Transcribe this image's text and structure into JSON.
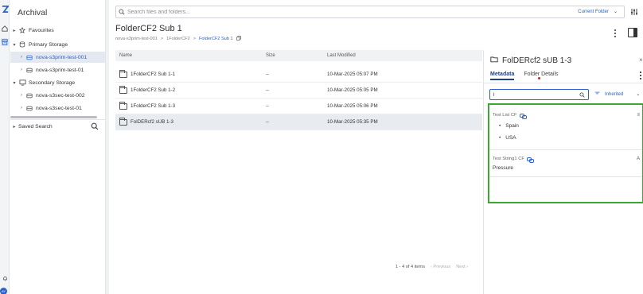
{
  "app": {
    "title": "Archival"
  },
  "rail": {
    "icons": [
      "logo-icon",
      "home-icon",
      "archive-icon",
      "bell-icon",
      "user-avatar"
    ],
    "avatar_initials": "AY"
  },
  "sidebar": {
    "items": [
      {
        "label": "Favourites",
        "icon": "star-icon",
        "level": 0,
        "caret": "▸"
      },
      {
        "label": "Primary Storage",
        "icon": "database-icon",
        "level": 0,
        "caret": "▾"
      },
      {
        "label": "nova-s3prim-test-001",
        "icon": "drive-icon",
        "level": 1,
        "caret": "›",
        "selected": true
      },
      {
        "label": "nova-s3prim-test-01",
        "icon": "drive-icon",
        "level": 1,
        "caret": "›"
      },
      {
        "label": "Secondary Storage",
        "icon": "monitor-icon",
        "level": 0,
        "caret": "▾"
      },
      {
        "label": "nova-s3sec-test-002",
        "icon": "drive-icon",
        "level": 1,
        "caret": "›"
      },
      {
        "label": "nova-s3sec-test-01",
        "icon": "drive-icon",
        "level": 1,
        "caret": "›"
      }
    ],
    "saved_search": {
      "label": "Saved Search",
      "caret": "▸"
    }
  },
  "search": {
    "placeholder": "Search files and folders...",
    "scope": "Current Folder"
  },
  "page": {
    "title": "FolderCF2 Sub 1",
    "breadcrumb": [
      "nova-s3prim-test-001",
      ">",
      "1FolderCF2",
      ">",
      "FolderCF2 Sub 1"
    ]
  },
  "table": {
    "headers": {
      "name": "Name",
      "size": "Size",
      "modified": "Last Modified"
    },
    "rows": [
      {
        "name": "1FolderCF2 Sub 1-1",
        "size": "--",
        "modified": "10-Mar-2025 05:07 PM"
      },
      {
        "name": "1FolderCF2 Sub 1-2",
        "size": "--",
        "modified": "10-Mar-2025 05:05 PM"
      },
      {
        "name": "1FolderCF2 Sub 1-3",
        "size": "--",
        "modified": "10-Mar-2025 05:06 PM"
      },
      {
        "name": "FolDERcf2 sUB 1-3",
        "size": "--",
        "modified": "10-Mar-2025 05:35 PM",
        "selected": true
      }
    ],
    "pager": {
      "summary": "1 - 4 of 4 items",
      "prev": "‹ Previous",
      "next": "Next ›"
    }
  },
  "details": {
    "title": "FolDERcf2 sUB 1-3",
    "close": "×",
    "tabs": [
      "Metadata",
      "Folder Details"
    ],
    "filter_value": "l",
    "inherited_label": "Inherited",
    "properties": [
      {
        "name": "Test List CF",
        "values": [
          "Spain",
          "USA"
        ],
        "toggle": "≡"
      },
      {
        "name": "Test String1 CF",
        "values": [
          "Pressure"
        ],
        "toggle": "A"
      }
    ]
  },
  "colors": {
    "accent": "#2c62c7",
    "highlight_border": "#3aa832",
    "notification_dot": "#d32020"
  }
}
